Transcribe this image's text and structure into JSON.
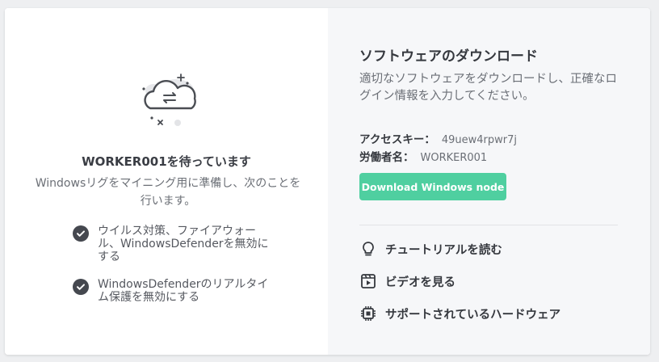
{
  "waiting": {
    "title": "WORKER001を待っています",
    "description": "Windowsリグをマイニング用に準備し、次のことを行います。",
    "tasks": [
      "ウイルス対策、ファイアウォール、WindowsDefenderを無効にする",
      "WindowsDefenderのリアルタイム保護を無効にする"
    ]
  },
  "download": {
    "title": "ソフトウェアのダウンロード",
    "description": "適切なソフトウェアをダウンロードし、正確なログイン情報を入力してください。",
    "access_key_label": "アクセスキー：",
    "access_key_value": "49uew4rpwr7j",
    "worker_label": "労働者名：",
    "worker_value": "WORKER001",
    "button_label": "Download Windows node"
  },
  "links": [
    {
      "label": "チュートリアルを読む",
      "icon": "lightbulb-icon"
    },
    {
      "label": "ビデオを見る",
      "icon": "video-icon"
    },
    {
      "label": "サポートされているハードウェア",
      "icon": "chip-icon"
    }
  ],
  "colors": {
    "accent": "#4fcfa0",
    "panel_right": "#f6f7f9",
    "page_bg": "#eeeff1",
    "text_dark": "#35383e",
    "text_muted": "#6b6f76"
  }
}
